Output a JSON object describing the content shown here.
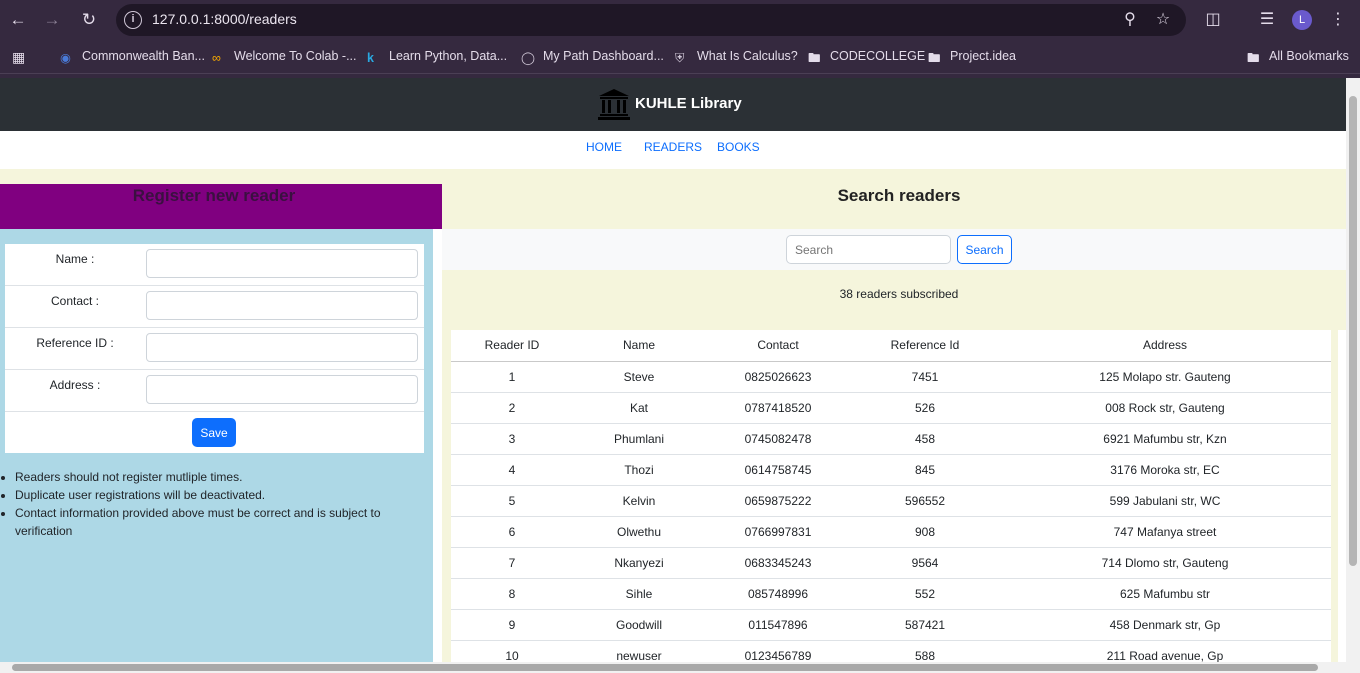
{
  "browser": {
    "url": "127.0.0.1:8000/readers",
    "profile_initial": "L",
    "bookmarks": [
      "Commonwealth Ban...",
      "Welcome To Colab -...",
      "Learn Python, Data...",
      "My Path Dashboard...",
      "What Is Calculus?",
      "CODECOLLEGE",
      "Project.idea"
    ],
    "all_bookmarks": "All Bookmarks"
  },
  "site": {
    "title": "KUHLE Library",
    "nav": [
      "HOME",
      "READERS",
      "BOOKS"
    ]
  },
  "register": {
    "heading": "Register new reader",
    "fields": [
      {
        "label": "Name :"
      },
      {
        "label": "Contact :"
      },
      {
        "label": "Reference ID :"
      },
      {
        "label": "Address :"
      }
    ],
    "save_label": "Save",
    "notes": [
      "Readers should not register mutliple times.",
      "Duplicate user registrations will be deactivated.",
      "Contact information provided above must be correct and is subject to verification"
    ]
  },
  "search": {
    "heading": "Search readers",
    "placeholder": "Search",
    "button_label": "Search",
    "count_text": "38 readers subscribed"
  },
  "table": {
    "headers": [
      "Reader ID",
      "Name",
      "Contact",
      "Reference Id",
      "Address"
    ],
    "rows": [
      [
        "1",
        "Steve",
        "0825026623",
        "7451",
        "125 Molapo str. Gauteng"
      ],
      [
        "2",
        "Kat",
        "0787418520",
        "526",
        "008 Rock str, Gauteng"
      ],
      [
        "3",
        "Phumlani",
        "0745082478",
        "458",
        "6921 Mafumbu str, Kzn"
      ],
      [
        "4",
        "Thozi",
        "0614758745",
        "845",
        "3176 Moroka str, EC"
      ],
      [
        "5",
        "Kelvin",
        "0659875222",
        "596552",
        "599 Jabulani str, WC"
      ],
      [
        "6",
        "Olwethu",
        "0766997831",
        "908",
        "747 Mafanya street"
      ],
      [
        "7",
        "Nkanyezi",
        "0683345243",
        "9564",
        "714 Dlomo str, Gauteng"
      ],
      [
        "8",
        "Sihle",
        "085748996",
        "552",
        "625 Mafumbu str"
      ],
      [
        "9",
        "Goodwill",
        "011547896",
        "587421",
        "458 Denmark str, Gp"
      ],
      [
        "10",
        "newuser",
        "0123456789",
        "588",
        "211 Road avenue, Gp"
      ]
    ]
  }
}
